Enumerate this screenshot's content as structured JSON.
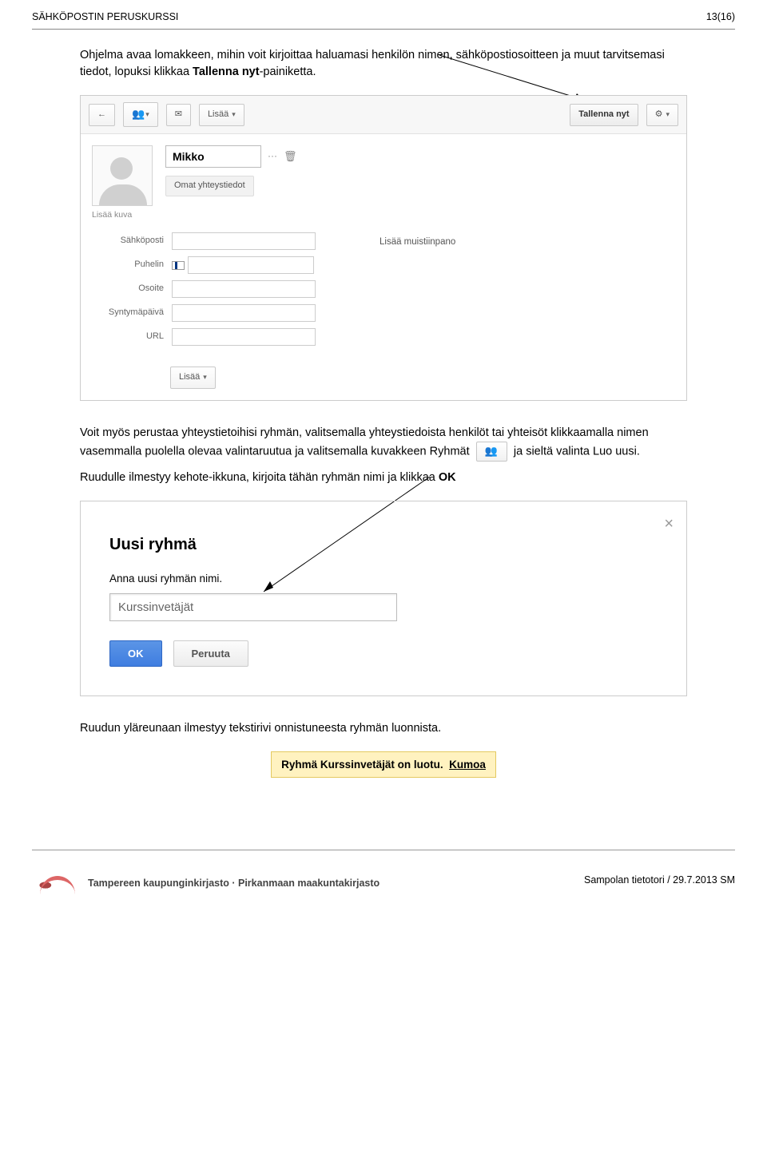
{
  "header": {
    "doc_title": "SÄHKÖPOSTIN PERUSKURSSI",
    "page_info": "13(16)"
  },
  "paragraphs": {
    "p1_a": "Ohjelma avaa lomakkeen, mihin voit kirjoittaa haluamasi henkilön nimen, sähköpostiosoitteen ja muut tarvitsemasi tiedot, lopuksi klikkaa ",
    "p1_b": "Tallenna nyt",
    "p1_c": "-painiketta.",
    "p2_a": "Voit myös perustaa yhteystietoihisi ryhmän, valitsemalla yhteystiedoista henkilöt tai yhteisöt klikkaamalla nimen vasemmalla puolella olevaa valintaruutua ja valitsemalla kuvakkeen Ryhmät",
    "p2_b": "ja sieltä valinta Luo uusi.",
    "p3_a": "Ruudulle ilmestyy kehote-ikkuna, kirjoita tähän ryhmän nimi ja klikkaa ",
    "p3_b": "OK",
    "p4": "Ruudun yläreunaan ilmestyy tekstirivi onnistuneesta ryhmän luonnista."
  },
  "contact_editor": {
    "toolbar": {
      "back": {
        "aria": "back"
      },
      "groups": {
        "aria": "groups"
      },
      "mail": {
        "aria": "mail"
      },
      "more_label": "Lisää",
      "save_label": "Tallenna nyt",
      "settings": {
        "aria": "settings"
      }
    },
    "avatar_label": "Lisää kuva",
    "name_value": "Mikko",
    "name_more": "···",
    "own_details_tab": "Omat yhteystiedot",
    "fields": {
      "email": "Sähköposti",
      "phone": "Puhelin",
      "address": "Osoite",
      "birthday": "Syntymäpäivä",
      "url": "URL"
    },
    "note_label": "Lisää muistiinpano",
    "footer_more": "Lisää"
  },
  "dialog": {
    "title": "Uusi ryhmä",
    "sub": "Anna uusi ryhmän nimi.",
    "input_value": "Kurssinvetäjät",
    "ok": "OK",
    "cancel": "Peruuta"
  },
  "toast": {
    "msg": "Ryhmä Kurssinvetäjät on luotu.",
    "undo": "Kumoa"
  },
  "footer": {
    "library": "Tampereen kaupunginkirjasto · Pirkanmaan maakuntakirjasto",
    "right": "Sampolan tietotori / 29.7.2013 SM"
  }
}
